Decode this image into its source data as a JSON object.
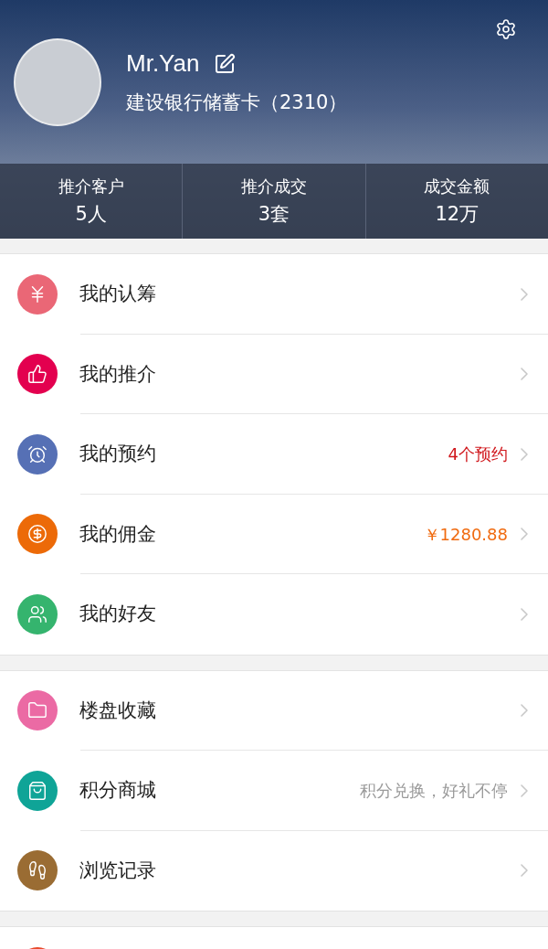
{
  "profile": {
    "name": "Mr.Yan",
    "card": "建设银行储蓄卡（2310）"
  },
  "stats": [
    {
      "label": "推介客户",
      "value": "5人"
    },
    {
      "label": "推介成交",
      "value": "3套"
    },
    {
      "label": "成交金额",
      "value": "12万"
    }
  ],
  "sections": [
    {
      "items": [
        {
          "kind": "yen",
          "color": "#ea6776",
          "label": "我的认筹"
        },
        {
          "kind": "thumb",
          "color": "#e3004f",
          "label": "我的推介"
        },
        {
          "kind": "alarm",
          "color": "#5670b5",
          "label": "我的预约",
          "detail": {
            "text": "4个预约",
            "color": "#d0161b"
          }
        },
        {
          "kind": "coin",
          "color": "#ec6a08",
          "label": "我的佣金",
          "detail": {
            "text": "￥1280.88",
            "color": "#f06a0f"
          }
        },
        {
          "kind": "friends",
          "color": "#35b46e",
          "label": "我的好友"
        }
      ]
    },
    {
      "items": [
        {
          "kind": "folder",
          "color": "#eb6aa4",
          "label": "楼盘收藏"
        },
        {
          "kind": "bag",
          "color": "#0fa497",
          "label": "积分商城",
          "detail": {
            "text": "积分兑换，好礼不停",
            "color": "#9a9a9a"
          }
        },
        {
          "kind": "foot",
          "color": "#9a6c33",
          "label": "浏览记录"
        }
      ]
    },
    {
      "items": [
        {
          "kind": "blank",
          "color": "#e8492b"
        }
      ]
    }
  ]
}
